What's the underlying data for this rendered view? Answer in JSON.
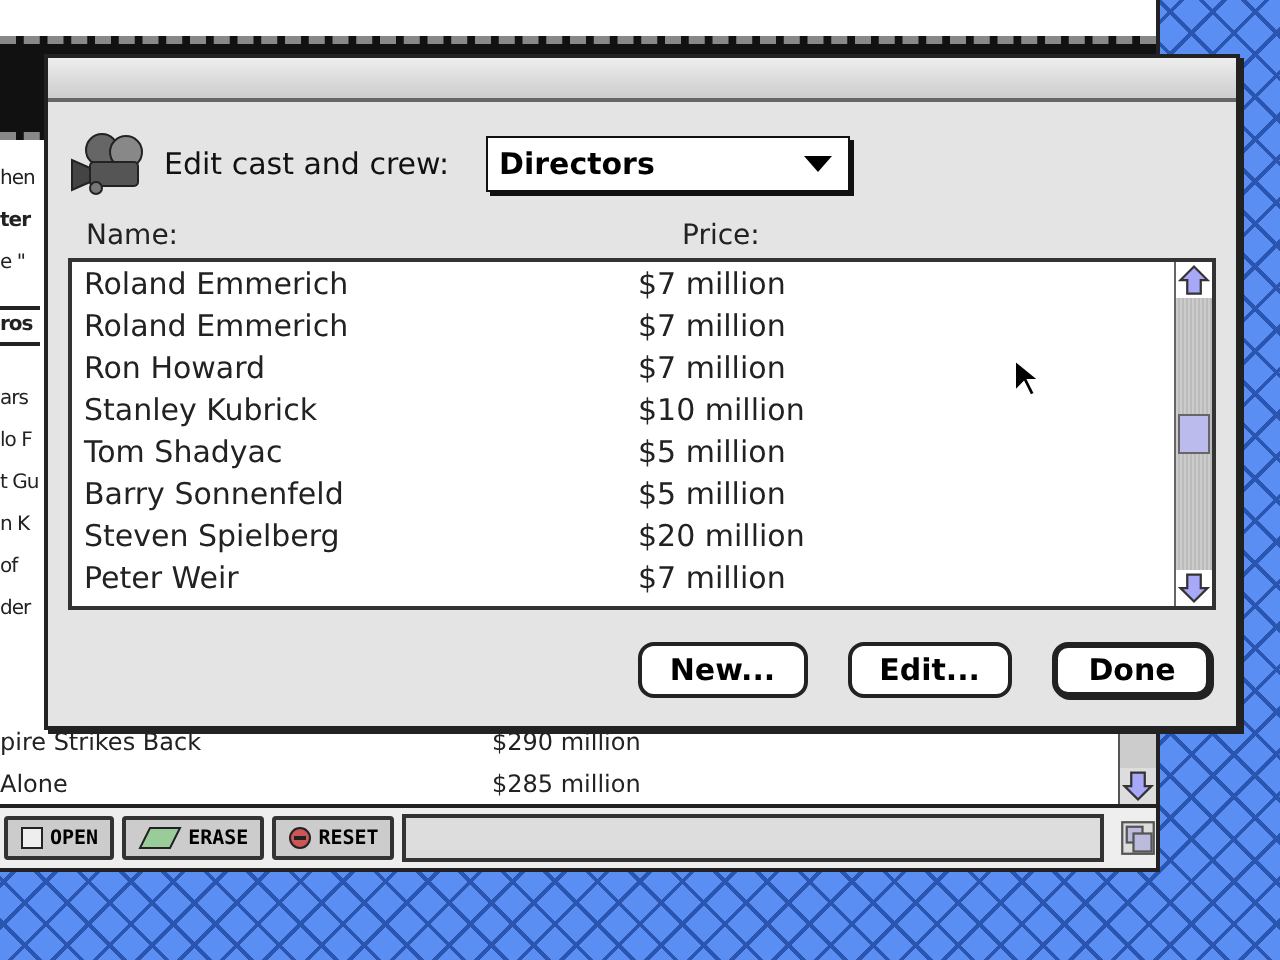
{
  "background_window": {
    "fragments": [
      {
        "text": "hen",
        "kind": "plain"
      },
      {
        "text": "ter",
        "kind": "bold"
      },
      {
        "text": "e \"",
        "kind": "plain"
      },
      {
        "text": "ros",
        "kind": "boxed"
      },
      {
        "text": "ars",
        "kind": "plain"
      },
      {
        "text": "lo F",
        "kind": "plain"
      },
      {
        "text": "t Gu",
        "kind": "plain"
      },
      {
        "text": "n K",
        "kind": "plain"
      },
      {
        "text": "of",
        "kind": "plain"
      },
      {
        "text": "der",
        "kind": "plain"
      }
    ],
    "rows": [
      {
        "title": "pire Strikes Back",
        "gross": "$290 million"
      },
      {
        "title": "Alone",
        "gross": "$285 million"
      }
    ],
    "toolbar": [
      {
        "label": "OPEN",
        "kind": "open"
      },
      {
        "label": "ERASE",
        "kind": "erase"
      },
      {
        "label": "RESET",
        "kind": "reset"
      }
    ]
  },
  "dialog": {
    "label": "Edit cast and crew:",
    "dropdown": "Directors",
    "columns": [
      "Name:",
      "Price:"
    ],
    "rows": [
      {
        "name": "Roland Emmerich",
        "price": "$7 million"
      },
      {
        "name": "Roland Emmerich",
        "price": "$7 million"
      },
      {
        "name": "Ron Howard",
        "price": "$7 million"
      },
      {
        "name": "Stanley Kubrick",
        "price": "$10 million"
      },
      {
        "name": "Tom Shadyac",
        "price": "$5 million"
      },
      {
        "name": "Barry Sonnenfeld",
        "price": "$5 million"
      },
      {
        "name": "Steven Spielberg",
        "price": "$20 million"
      },
      {
        "name": "Peter Weir",
        "price": "$7 million"
      }
    ],
    "buttons": [
      {
        "label": "New...",
        "default": false
      },
      {
        "label": "Edit...",
        "default": false
      },
      {
        "label": "Done",
        "default": true
      }
    ]
  }
}
